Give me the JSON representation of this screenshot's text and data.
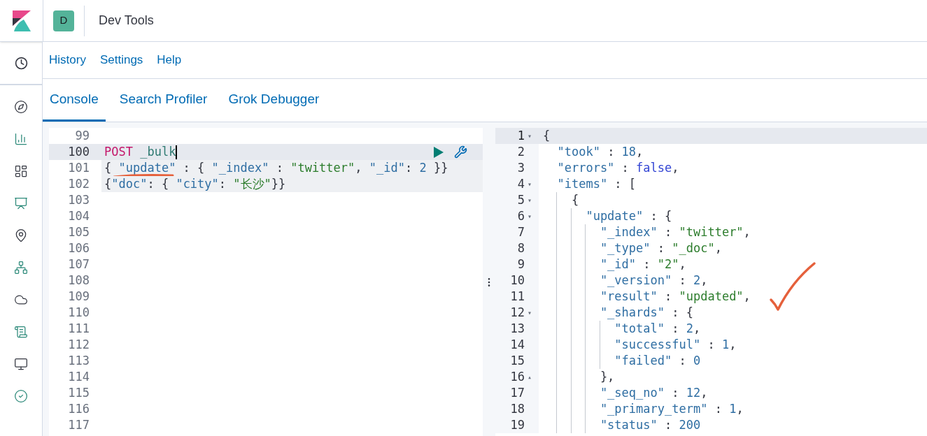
{
  "header": {
    "avatar": "D",
    "title": "Dev Tools"
  },
  "nav_links": [
    "History",
    "Settings",
    "Help"
  ],
  "tabs": [
    {
      "label": "Console",
      "selected": true
    },
    {
      "label": "Search Profiler",
      "selected": false
    },
    {
      "label": "Grok Debugger",
      "selected": false
    }
  ],
  "request": {
    "lines": [
      {
        "number": "99",
        "active": false,
        "in_request": false
      },
      {
        "number": "100",
        "active": true,
        "in_request": true,
        "tokens": [
          {
            "text": "POST",
            "kind": "method"
          },
          {
            "text": " _bulk",
            "kind": "path"
          }
        ]
      },
      {
        "number": "101",
        "active": false,
        "in_request": true,
        "tokens": [
          {
            "text": "{ ",
            "kind": "punct"
          },
          {
            "text": "\"update\"",
            "kind": "key"
          },
          {
            "text": " : { ",
            "kind": "punct"
          },
          {
            "text": "\"_index\"",
            "kind": "key"
          },
          {
            "text": " : ",
            "kind": "punct"
          },
          {
            "text": "\"twitter\"",
            "kind": "string"
          },
          {
            "text": ", ",
            "kind": "punct"
          },
          {
            "text": "\"_id\"",
            "kind": "key"
          },
          {
            "text": ": ",
            "kind": "punct"
          },
          {
            "text": "2",
            "kind": "number"
          },
          {
            "text": " }}",
            "kind": "punct"
          }
        ]
      },
      {
        "number": "102",
        "active": false,
        "in_request": true,
        "tokens": [
          {
            "text": "{",
            "kind": "punct"
          },
          {
            "text": "\"doc\"",
            "kind": "key"
          },
          {
            "text": ": { ",
            "kind": "punct"
          },
          {
            "text": "\"city\"",
            "kind": "key"
          },
          {
            "text": ": ",
            "kind": "punct"
          },
          {
            "text": "\"长沙\"",
            "kind": "string"
          },
          {
            "text": "}}",
            "kind": "punct"
          }
        ]
      },
      {
        "number": "103",
        "active": false,
        "in_request": false
      },
      {
        "number": "104",
        "active": false,
        "in_request": false
      },
      {
        "number": "105",
        "active": false,
        "in_request": false
      },
      {
        "number": "106",
        "active": false,
        "in_request": false
      },
      {
        "number": "107",
        "active": false,
        "in_request": false
      },
      {
        "number": "108",
        "active": false,
        "in_request": false
      },
      {
        "number": "109",
        "active": false,
        "in_request": false
      },
      {
        "number": "110",
        "active": false,
        "in_request": false
      },
      {
        "number": "111",
        "active": false,
        "in_request": false
      },
      {
        "number": "112",
        "active": false,
        "in_request": false
      },
      {
        "number": "113",
        "active": false,
        "in_request": false
      },
      {
        "number": "114",
        "active": false,
        "in_request": false
      },
      {
        "number": "115",
        "active": false,
        "in_request": false
      },
      {
        "number": "116",
        "active": false,
        "in_request": false
      },
      {
        "number": "117",
        "active": false,
        "in_request": false
      }
    ]
  },
  "response": {
    "lines": [
      {
        "number": "1",
        "active": true,
        "fold": "▾",
        "tokens": [
          {
            "text": "{",
            "kind": "punct"
          }
        ],
        "children": [
          {
            "number": "2",
            "active": false,
            "tokens": [
              {
                "text": "\"took\"",
                "kind": "key"
              },
              {
                "text": " : ",
                "kind": "punct"
              },
              {
                "text": "18",
                "kind": "number"
              },
              {
                "text": ",",
                "kind": "punct"
              }
            ]
          },
          {
            "number": "3",
            "active": false,
            "tokens": [
              {
                "text": "\"errors\"",
                "kind": "key"
              },
              {
                "text": " : ",
                "kind": "punct"
              },
              {
                "text": "false",
                "kind": "keyword"
              },
              {
                "text": ",",
                "kind": "punct"
              }
            ]
          },
          {
            "number": "4",
            "active": false,
            "fold": "▾",
            "tokens": [
              {
                "text": "\"items\"",
                "kind": "key"
              },
              {
                "text": " : [",
                "kind": "punct"
              }
            ],
            "children": [
              {
                "number": "5",
                "active": false,
                "fold": "▾",
                "tokens": [
                  {
                    "text": "{",
                    "kind": "punct"
                  }
                ],
                "children": [
                  {
                    "number": "6",
                    "active": false,
                    "fold": "▾",
                    "tokens": [
                      {
                        "text": "\"update\"",
                        "kind": "key"
                      },
                      {
                        "text": " : {",
                        "kind": "punct"
                      }
                    ],
                    "children": [
                      {
                        "number": "7",
                        "active": false,
                        "tokens": [
                          {
                            "text": "\"_index\"",
                            "kind": "key"
                          },
                          {
                            "text": " : ",
                            "kind": "punct"
                          },
                          {
                            "text": "\"twitter\"",
                            "kind": "string"
                          },
                          {
                            "text": ",",
                            "kind": "punct"
                          }
                        ]
                      },
                      {
                        "number": "8",
                        "active": false,
                        "tokens": [
                          {
                            "text": "\"_type\"",
                            "kind": "key"
                          },
                          {
                            "text": " : ",
                            "kind": "punct"
                          },
                          {
                            "text": "\"_doc\"",
                            "kind": "string"
                          },
                          {
                            "text": ",",
                            "kind": "punct"
                          }
                        ]
                      },
                      {
                        "number": "9",
                        "active": false,
                        "tokens": [
                          {
                            "text": "\"_id\"",
                            "kind": "key"
                          },
                          {
                            "text": " : ",
                            "kind": "punct"
                          },
                          {
                            "text": "\"2\"",
                            "kind": "string"
                          },
                          {
                            "text": ",",
                            "kind": "punct"
                          }
                        ]
                      },
                      {
                        "number": "10",
                        "active": false,
                        "tokens": [
                          {
                            "text": "\"_version\"",
                            "kind": "key"
                          },
                          {
                            "text": " : ",
                            "kind": "punct"
                          },
                          {
                            "text": "2",
                            "kind": "number"
                          },
                          {
                            "text": ",",
                            "kind": "punct"
                          }
                        ]
                      },
                      {
                        "number": "11",
                        "active": false,
                        "tokens": [
                          {
                            "text": "\"result\"",
                            "kind": "key"
                          },
                          {
                            "text": " : ",
                            "kind": "punct"
                          },
                          {
                            "text": "\"updated\"",
                            "kind": "string"
                          },
                          {
                            "text": ",",
                            "kind": "punct"
                          }
                        ]
                      },
                      {
                        "number": "12",
                        "active": false,
                        "fold": "▾",
                        "tokens": [
                          {
                            "text": "\"_shards\"",
                            "kind": "key"
                          },
                          {
                            "text": " : {",
                            "kind": "punct"
                          }
                        ],
                        "children": [
                          {
                            "number": "13",
                            "active": false,
                            "tokens": [
                              {
                                "text": "\"total\"",
                                "kind": "key"
                              },
                              {
                                "text": " : ",
                                "kind": "punct"
                              },
                              {
                                "text": "2",
                                "kind": "number"
                              },
                              {
                                "text": ",",
                                "kind": "punct"
                              }
                            ]
                          },
                          {
                            "number": "14",
                            "active": false,
                            "tokens": [
                              {
                                "text": "\"successful\"",
                                "kind": "key"
                              },
                              {
                                "text": " : ",
                                "kind": "punct"
                              },
                              {
                                "text": "1",
                                "kind": "number"
                              },
                              {
                                "text": ",",
                                "kind": "punct"
                              }
                            ]
                          },
                          {
                            "number": "15",
                            "active": false,
                            "tokens": [
                              {
                                "text": "\"failed\"",
                                "kind": "key"
                              },
                              {
                                "text": " : ",
                                "kind": "punct"
                              },
                              {
                                "text": "0",
                                "kind": "number"
                              }
                            ]
                          }
                        ]
                      },
                      {
                        "number": "16",
                        "active": false,
                        "fold": "▴",
                        "tokens": [
                          {
                            "text": "},",
                            "kind": "punct"
                          }
                        ]
                      },
                      {
                        "number": "17",
                        "active": false,
                        "tokens": [
                          {
                            "text": "\"_seq_no\"",
                            "kind": "key"
                          },
                          {
                            "text": " : ",
                            "kind": "punct"
                          },
                          {
                            "text": "12",
                            "kind": "number"
                          },
                          {
                            "text": ",",
                            "kind": "punct"
                          }
                        ]
                      },
                      {
                        "number": "18",
                        "active": false,
                        "tokens": [
                          {
                            "text": "\"_primary_term\"",
                            "kind": "key"
                          },
                          {
                            "text": " : ",
                            "kind": "punct"
                          },
                          {
                            "text": "1",
                            "kind": "number"
                          },
                          {
                            "text": ",",
                            "kind": "punct"
                          }
                        ]
                      },
                      {
                        "number": "19",
                        "active": false,
                        "tokens": [
                          {
                            "text": "\"status\"",
                            "kind": "key"
                          },
                          {
                            "text": " : ",
                            "kind": "punct"
                          },
                          {
                            "text": "200",
                            "kind": "number"
                          }
                        ]
                      }
                    ]
                  }
                ]
              }
            ]
          }
        ]
      }
    ]
  }
}
